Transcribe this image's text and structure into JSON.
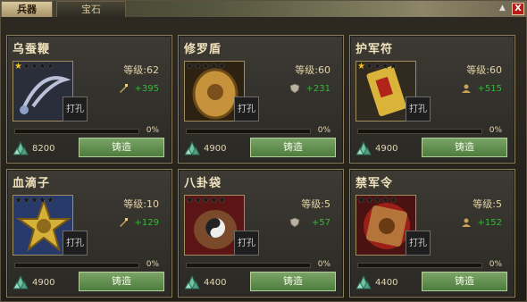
{
  "tabs": [
    {
      "label": "兵器",
      "active": true
    },
    {
      "label": "宝石",
      "active": false
    }
  ],
  "close_label": "X",
  "accent_colors": {
    "stat_green": "#36b53a",
    "button_green": "#5e8e4c",
    "star_gold": "#f4c21b",
    "close_red": "#b81c14"
  },
  "items": [
    {
      "name": "乌蚕鞭",
      "stars_filled": 1,
      "stars_total": 5,
      "level": "等级:62",
      "stat_icon": "sword-icon",
      "stat": "+395",
      "progress_percent": 0,
      "progress_label": "0%",
      "cost": "8200",
      "forge_label": "铸造",
      "punch_label": "打孔"
    },
    {
      "name": "修罗盾",
      "stars_filled": 0,
      "stars_total": 5,
      "level": "等级:60",
      "stat_icon": "shield-icon",
      "stat": "+231",
      "progress_percent": 0,
      "progress_label": "0%",
      "cost": "4900",
      "forge_label": "铸造",
      "punch_label": "打孔"
    },
    {
      "name": "护军符",
      "stars_filled": 1,
      "stars_total": 5,
      "level": "等级:60",
      "stat_icon": "person-icon",
      "stat": "+515",
      "progress_percent": 0,
      "progress_label": "0%",
      "cost": "4900",
      "forge_label": "铸造",
      "punch_label": "打孔"
    },
    {
      "name": "血滴子",
      "stars_filled": 0,
      "stars_total": 5,
      "level": "等级:10",
      "stat_icon": "sword-icon",
      "stat": "+129",
      "progress_percent": 0,
      "progress_label": "0%",
      "cost": "4900",
      "forge_label": "铸造",
      "punch_label": "打孔"
    },
    {
      "name": "八卦袋",
      "stars_filled": 0,
      "stars_total": 5,
      "level": "等级:5",
      "stat_icon": "shield-icon",
      "stat": "+57",
      "progress_percent": 0,
      "progress_label": "0%",
      "cost": "4400",
      "forge_label": "铸造",
      "punch_label": "打孔"
    },
    {
      "name": "禁军令",
      "stars_filled": 0,
      "stars_total": 5,
      "level": "等级:5",
      "stat_icon": "person-icon",
      "stat": "+152",
      "progress_percent": 0,
      "progress_label": "0%",
      "cost": "4400",
      "forge_label": "铸造",
      "punch_label": "打孔"
    }
  ]
}
